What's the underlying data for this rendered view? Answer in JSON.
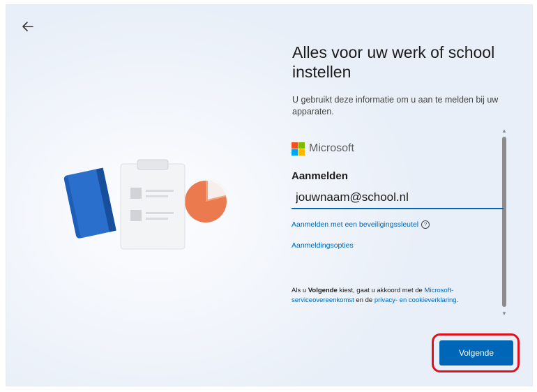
{
  "header": {
    "back_icon": "arrow-left-icon"
  },
  "main": {
    "title": "Alles voor uw werk of school instellen",
    "subtitle": "U gebruikt deze informatie om u aan te melden bij uw apparaten."
  },
  "signin": {
    "brand": "Microsoft",
    "heading": "Aanmelden",
    "email_value": "jouwnaam@school.nl",
    "security_key_link": "Aanmelden met een beveiligingssleutel",
    "help_icon": "?",
    "options_link": "Aanmeldingsopties",
    "terms_prefix": "Als u ",
    "terms_bold": "Volgende",
    "terms_middle": " kiest, gaat u akkoord met de ",
    "terms_link1": "Microsoft-serviceovereenkomst",
    "terms_and": " en de ",
    "terms_link2": "privacy- en cookieverklaring",
    "terms_end": "."
  },
  "footer": {
    "next_label": "Volgende"
  },
  "colors": {
    "accent": "#0067b8",
    "highlight": "#e0101d",
    "ms_red": "#f25022",
    "ms_green": "#7fba00",
    "ms_blue": "#00a4ef",
    "ms_yellow": "#ffb900"
  }
}
